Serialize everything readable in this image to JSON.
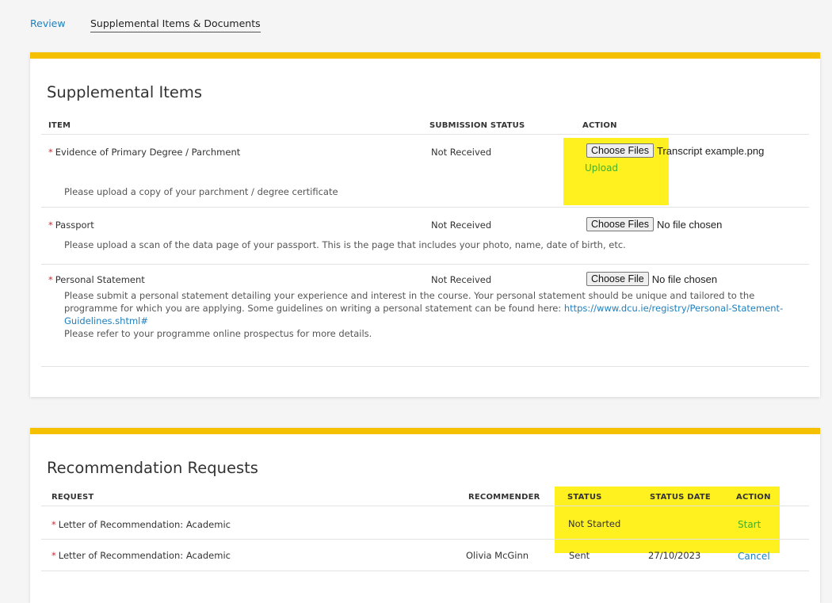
{
  "tabs": {
    "review": "Review",
    "supplemental": "Supplemental Items & Documents"
  },
  "supplemental": {
    "title": "Supplemental Items",
    "headers": {
      "item": "ITEM",
      "status": "SUBMISSION STATUS",
      "action": "ACTION"
    },
    "required_mark": "*",
    "items": [
      {
        "name": "Evidence of Primary Degree / Parchment",
        "status": "Not Received",
        "button": "Choose Files",
        "file": "Transcript example.png",
        "upload": "Upload",
        "description": "Please upload a copy of your parchment / degree certificate"
      },
      {
        "name": "Passport",
        "status": "Not Received",
        "button": "Choose Files",
        "file": "No file chosen",
        "description": "Please upload a scan of the data page of your passport. This is the page that includes your photo, name, date of birth, etc."
      },
      {
        "name": "Personal Statement",
        "status": "Not Received",
        "button": "Choose File",
        "file": "No file chosen",
        "description": "Please submit a personal statement detailing your experience and interest in the course. Your personal statement should be unique and tailored to the programme for which you are applying. Some guidelines on writing a personal statement can be found here: ",
        "link": "https://www.dcu.ie/registry/Personal-Statement-Guidelines.shtml#",
        "note": "Please refer to your programme online prospectus for more details."
      }
    ]
  },
  "recommendations": {
    "title": "Recommendation Requests",
    "headers": {
      "request": "REQUEST",
      "recommender": "RECOMMENDER",
      "status": "STATUS",
      "status_date": "STATUS DATE",
      "action": "ACTION"
    },
    "rows": [
      {
        "request": "Letter of Recommendation: Academic",
        "recommender": "",
        "status": "Not Started",
        "date": "",
        "action": "Start"
      },
      {
        "request": "Letter of Recommendation: Academic",
        "recommender": "Olivia McGinn",
        "status": "Sent",
        "date": "27/10/2023",
        "action": "Cancel"
      }
    ]
  },
  "colors": {
    "accent_bar": "#f5c000",
    "highlight": "#ffee00",
    "link_blue": "#1f7fbd",
    "link_green": "#43b02a",
    "required_red": "#d9262c"
  }
}
